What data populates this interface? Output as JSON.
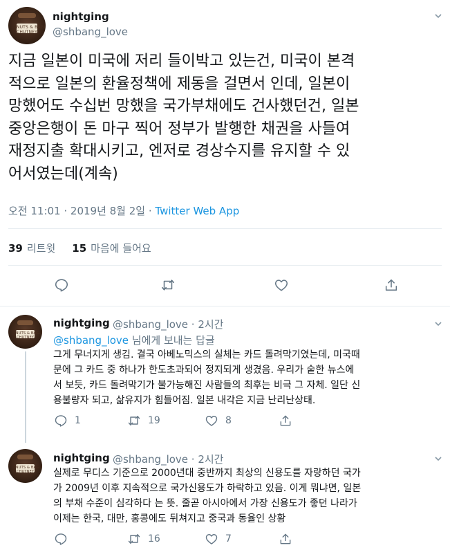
{
  "main_tweet": {
    "display_name": "nightging",
    "handle": "@shbang_love",
    "text": "지금 일본이 미국에 저리 들이박고 있는건, 미국이 본격\n적으로 일본의 환율정책에 제동을 걸면서 인데, 일본이\n망했어도 수십번 망했을 국가부채에도 건사했던건, 일본\n중앙은행이 돈 마구 찍어 정부가 발행한 채권을 사들여\n재정지출 확대시키고, 엔저로 경상수지를 유지할 수 있\n어서였는데(계속)",
    "timestamp": "오전 11:01 · 2019년 8월 2일",
    "separator": " · ",
    "source_app": "Twitter Web App",
    "retweet_count": "39",
    "retweet_label": "리트윗",
    "like_count": "15",
    "like_label": "마음에 들어요"
  },
  "avatar_label": "NUTS & BAGLE\nCHUTNEY",
  "replies": [
    {
      "display_name": "nightging",
      "handle_time": "@shbang_love · 2시간",
      "reply_prefix": "@shbang_love",
      "reply_suffix": " 님에게 보내는 답글",
      "text": "그게 무너지게 생김. 결국 아베노믹스의 실체는 카드 돌려막기였는데, 미국때\n문에 그 카드 중 하나가 한도초과되어 정지되게 생겼음. 우리가 숱한 뉴스에\n서 보듯, 카드 돌려막기가 불가능해진 사람들의 최후는 비극 그 자체. 일단 신\n용불량자 되고, 삶유지가 힘들어짐. 일본 내각은 지금 난리난상태.",
      "reply_count": "1",
      "retweet_count": "19",
      "like_count": "8"
    },
    {
      "display_name": "nightging",
      "handle_time": "@shbang_love · 2시간",
      "text": "실제로 무디스 기준으로 2000년대 중반까지 최상의 신용도를 자랑하던 국가\n가 2009년 이후 지속적으로 국가신용도가 하락하고 있음. 이게 뭐냐면, 일본\n의 부채 수준이 심각하다 는 뜻. 줄곧 아시아에서 가장 신용도가 좋던 나라가\n이제는 한국, 대만, 홍콩에도 뒤쳐지고 중국과 동율인 상황",
      "reply_count": "",
      "retweet_count": "16",
      "like_count": "7"
    }
  ],
  "colors": {
    "accent": "#1b95e0",
    "secondary_text": "#657786",
    "primary_text": "#14171a",
    "divider": "#e6ecf0"
  },
  "icons": [
    "chevron-down-icon",
    "reply-icon",
    "retweet-icon",
    "like-icon",
    "share-icon"
  ]
}
